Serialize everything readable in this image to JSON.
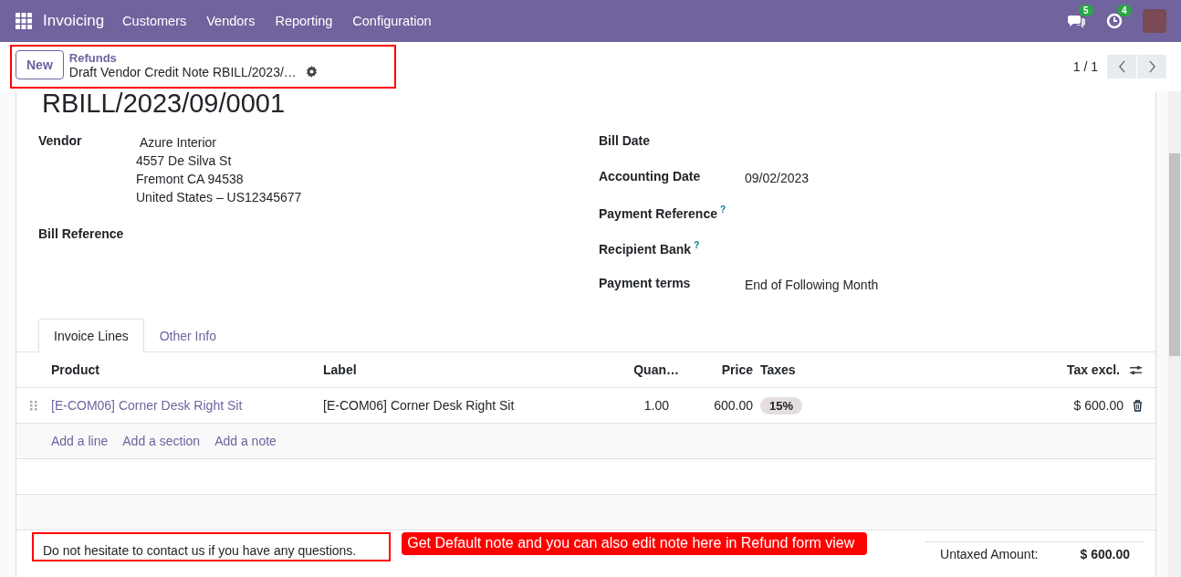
{
  "navbar": {
    "app": "Invoicing",
    "menu": [
      "Customers",
      "Vendors",
      "Reporting",
      "Configuration"
    ],
    "messages_count": "5",
    "activities_count": "4"
  },
  "control_panel": {
    "new_button": "New",
    "breadcrumb_parent": "Refunds",
    "record_title": "Draft Vendor Credit Note RBILL/2023/…",
    "highlighted": true,
    "pager": "1 / 1"
  },
  "form": {
    "name": "RBILL/2023/09/0001",
    "left_fields": [
      {
        "label": "Vendor",
        "lines": [
          "Azure Interior",
          "4557 De Silva St",
          "Fremont CA 94538",
          "United States – US12345677"
        ]
      },
      {
        "label": "Bill Reference"
      }
    ],
    "right_fields": [
      {
        "label": "Bill Date"
      },
      {
        "label": "Accounting Date",
        "value": "09/02/2023"
      },
      {
        "label": "Payment Reference",
        "help": "?"
      },
      {
        "label": "Recipient Bank",
        "help": "?"
      },
      {
        "label": "Payment terms",
        "value": "End of Following Month"
      }
    ]
  },
  "tabs": [
    {
      "label": "Invoice Lines",
      "selected": true
    },
    {
      "label": "Other Info",
      "selected": false
    }
  ],
  "table": {
    "columns": [
      "Product",
      "Label",
      "Quan…",
      "Price",
      "Taxes",
      "Tax excl."
    ],
    "rows": [
      {
        "product": "[E-COM06] Corner Desk Right Sit",
        "label": "[E-COM06] Corner Desk Right Sit",
        "quantity": "1.00",
        "price": "600.00",
        "taxes": [
          "15%"
        ],
        "subtotal": "$ 600.00"
      }
    ],
    "add_links": [
      "Add a line",
      "Add a section",
      "Add a note"
    ]
  },
  "note": {
    "text": "Do not hesitate to contact us if you have any questions.",
    "highlighted": true
  },
  "callout": "Get Default note and you can also edit note here in Refund form view",
  "totals": [
    {
      "label": "Untaxed Amount:",
      "value": "$ 600.00"
    }
  ]
}
